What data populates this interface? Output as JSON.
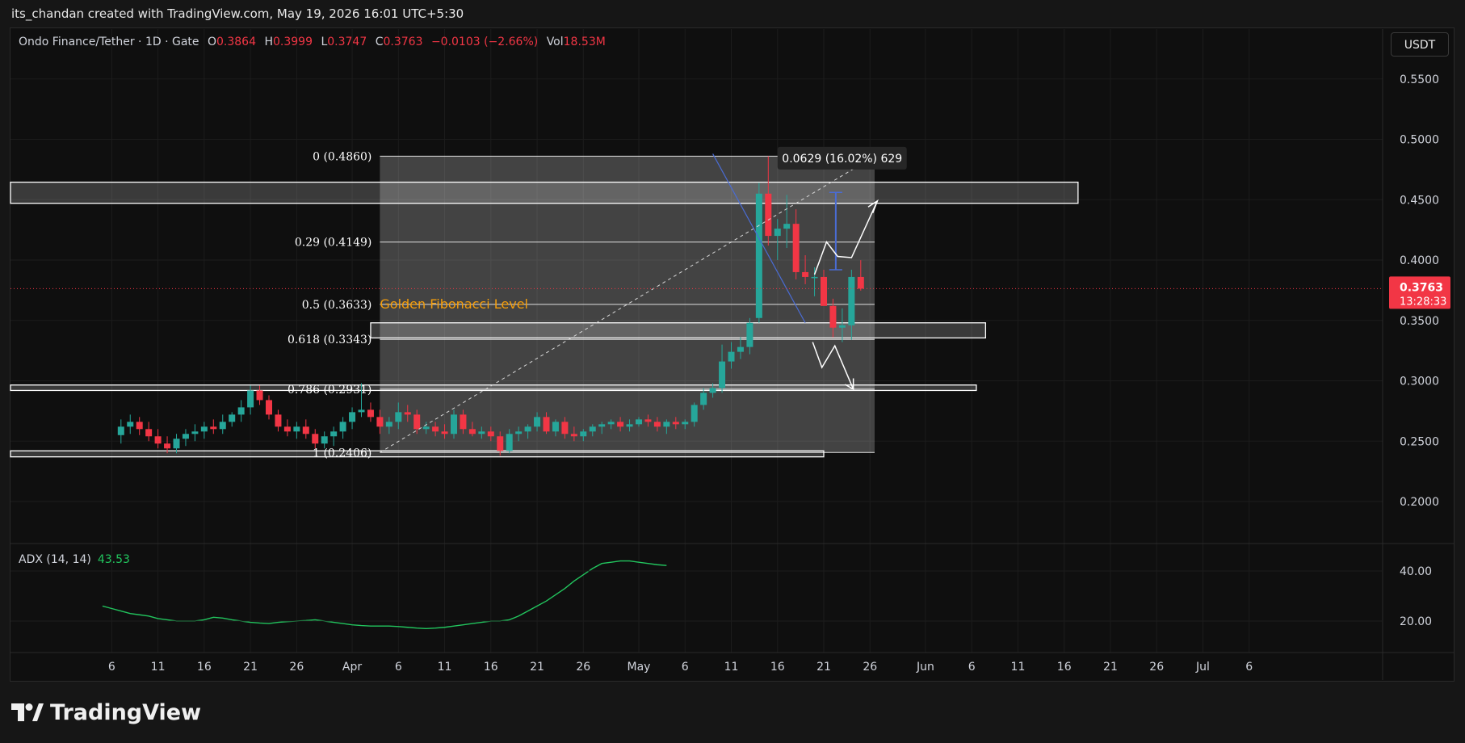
{
  "header": {
    "attribution": "its_chandan created with TradingView.com, May 19, 2026 16:01 UTC+5:30"
  },
  "legend": {
    "symbol": "Ondo Finance/Tether · 1D · Gate",
    "open_label": "O",
    "open": "0.3864",
    "high_label": "H",
    "high": "0.3999",
    "low_label": "L",
    "low": "0.3747",
    "close_label": "C",
    "close": "0.3763",
    "change": "−0.0103 (−2.66%)",
    "vol_label": "Vol",
    "vol": "18.53M"
  },
  "currency_button": "USDT",
  "price_badge": {
    "price": "0.3763",
    "countdown": "13:28:33"
  },
  "adx": {
    "label": "ADX (14, 14)",
    "value": "43.53"
  },
  "brand": "TradingView",
  "colors": {
    "up": "#26a69a",
    "down": "#f23645",
    "adx": "#22c55e",
    "annotation": "#ffffff",
    "trendline": "#4a6cd4",
    "golden_label": "#f59e0b"
  },
  "chart_data": {
    "type": "candlestick",
    "title": "Ondo Finance/Tether · 1D · Gate",
    "ylabel": "USDT",
    "ylim": [
      0.175,
      0.57
    ],
    "y_ticks": [
      "0.5500",
      "0.5000",
      "0.4500",
      "0.4000",
      "0.3500",
      "0.3000",
      "0.2500",
      "0.2000"
    ],
    "x_tick_labels": [
      "6",
      "11",
      "16",
      "21",
      "26",
      "Apr",
      "6",
      "11",
      "16",
      "21",
      "26",
      "May",
      "6",
      "11",
      "16",
      "21",
      "26",
      "Jun",
      "6",
      "11",
      "16",
      "21",
      "26",
      "Jul",
      "6"
    ],
    "x_tick_days": [
      -57,
      -52,
      -47,
      -42,
      -37,
      -31,
      -26,
      -21,
      -16,
      -11,
      -6,
      0,
      5,
      10,
      15,
      20,
      25,
      31,
      36,
      41,
      46,
      51,
      56,
      61,
      66
    ],
    "x_day_note": "days relative to May 1",
    "candles_ohlc": [
      [
        0.255,
        0.268,
        0.248,
        0.262
      ],
      [
        0.262,
        0.272,
        0.256,
        0.266
      ],
      [
        0.266,
        0.27,
        0.255,
        0.26
      ],
      [
        0.26,
        0.266,
        0.25,
        0.254
      ],
      [
        0.254,
        0.26,
        0.244,
        0.248
      ],
      [
        0.248,
        0.254,
        0.24,
        0.244
      ],
      [
        0.244,
        0.256,
        0.24,
        0.252
      ],
      [
        0.252,
        0.26,
        0.246,
        0.256
      ],
      [
        0.256,
        0.264,
        0.25,
        0.258
      ],
      [
        0.258,
        0.266,
        0.252,
        0.262
      ],
      [
        0.262,
        0.268,
        0.256,
        0.26
      ],
      [
        0.26,
        0.272,
        0.256,
        0.266
      ],
      [
        0.266,
        0.274,
        0.262,
        0.272
      ],
      [
        0.272,
        0.284,
        0.266,
        0.278
      ],
      [
        0.278,
        0.296,
        0.272,
        0.292
      ],
      [
        0.292,
        0.296,
        0.28,
        0.284
      ],
      [
        0.284,
        0.288,
        0.268,
        0.272
      ],
      [
        0.272,
        0.276,
        0.258,
        0.262
      ],
      [
        0.262,
        0.268,
        0.254,
        0.258
      ],
      [
        0.258,
        0.266,
        0.252,
        0.262
      ],
      [
        0.262,
        0.268,
        0.252,
        0.256
      ],
      [
        0.256,
        0.26,
        0.244,
        0.248
      ],
      [
        0.248,
        0.258,
        0.244,
        0.254
      ],
      [
        0.254,
        0.262,
        0.246,
        0.258
      ],
      [
        0.258,
        0.27,
        0.252,
        0.266
      ],
      [
        0.266,
        0.278,
        0.26,
        0.274
      ],
      [
        0.274,
        0.298,
        0.27,
        0.276
      ],
      [
        0.276,
        0.282,
        0.266,
        0.27
      ],
      [
        0.27,
        0.276,
        0.256,
        0.262
      ],
      [
        0.262,
        0.27,
        0.256,
        0.266
      ],
      [
        0.266,
        0.282,
        0.26,
        0.274
      ],
      [
        0.274,
        0.28,
        0.266,
        0.272
      ],
      [
        0.272,
        0.276,
        0.256,
        0.26
      ],
      [
        0.26,
        0.266,
        0.256,
        0.262
      ],
      [
        0.262,
        0.266,
        0.254,
        0.258
      ],
      [
        0.258,
        0.264,
        0.252,
        0.256
      ],
      [
        0.256,
        0.276,
        0.252,
        0.272
      ],
      [
        0.272,
        0.276,
        0.256,
        0.26
      ],
      [
        0.26,
        0.266,
        0.254,
        0.256
      ],
      [
        0.256,
        0.262,
        0.252,
        0.258
      ],
      [
        0.258,
        0.262,
        0.25,
        0.254
      ],
      [
        0.254,
        0.258,
        0.238,
        0.242
      ],
      [
        0.242,
        0.26,
        0.24,
        0.256
      ],
      [
        0.256,
        0.262,
        0.25,
        0.258
      ],
      [
        0.258,
        0.264,
        0.252,
        0.262
      ],
      [
        0.262,
        0.274,
        0.258,
        0.27
      ],
      [
        0.27,
        0.274,
        0.256,
        0.258
      ],
      [
        0.258,
        0.268,
        0.254,
        0.266
      ],
      [
        0.266,
        0.27,
        0.252,
        0.256
      ],
      [
        0.256,
        0.262,
        0.25,
        0.254
      ],
      [
        0.254,
        0.26,
        0.25,
        0.258
      ],
      [
        0.258,
        0.264,
        0.254,
        0.262
      ],
      [
        0.262,
        0.266,
        0.256,
        0.264
      ],
      [
        0.264,
        0.268,
        0.26,
        0.266
      ],
      [
        0.266,
        0.27,
        0.258,
        0.262
      ],
      [
        0.262,
        0.268,
        0.258,
        0.264
      ],
      [
        0.264,
        0.27,
        0.262,
        0.268
      ],
      [
        0.268,
        0.272,
        0.262,
        0.266
      ],
      [
        0.266,
        0.27,
        0.258,
        0.262
      ],
      [
        0.262,
        0.268,
        0.256,
        0.266
      ],
      [
        0.266,
        0.27,
        0.26,
        0.264
      ],
      [
        0.264,
        0.268,
        0.26,
        0.266
      ],
      [
        0.266,
        0.282,
        0.262,
        0.28
      ],
      [
        0.28,
        0.294,
        0.276,
        0.29
      ],
      [
        0.29,
        0.298,
        0.286,
        0.294
      ],
      [
        0.294,
        0.33,
        0.29,
        0.316
      ],
      [
        0.316,
        0.332,
        0.31,
        0.324
      ],
      [
        0.324,
        0.336,
        0.318,
        0.328
      ],
      [
        0.328,
        0.352,
        0.322,
        0.348
      ],
      [
        0.352,
        0.464,
        0.348,
        0.455
      ],
      [
        0.455,
        0.486,
        0.412,
        0.42
      ],
      [
        0.42,
        0.434,
        0.4,
        0.426
      ],
      [
        0.426,
        0.454,
        0.41,
        0.43
      ],
      [
        0.43,
        0.442,
        0.384,
        0.39
      ],
      [
        0.39,
        0.404,
        0.38,
        0.386
      ],
      [
        0.386,
        0.394,
        0.37,
        0.386
      ],
      [
        0.386,
        0.392,
        0.366,
        0.362
      ],
      [
        0.362,
        0.368,
        0.336,
        0.344
      ],
      [
        0.344,
        0.36,
        0.332,
        0.346
      ],
      [
        0.346,
        0.392,
        0.334,
        0.386
      ],
      [
        0.386,
        0.3999,
        0.3747,
        0.3763
      ]
    ],
    "candles_first_day": -56,
    "fibonacci": {
      "levels": [
        {
          "ratio_label": "0 (0.4860)",
          "price": 0.486
        },
        {
          "ratio_label": "0.29 (0.4149)",
          "price": 0.4149
        },
        {
          "ratio_label": "0.5 (0.3633)",
          "price": 0.3633
        },
        {
          "ratio_label": "0.618 (0.3343)",
          "price": 0.3343
        },
        {
          "ratio_label": "0.786 (0.2931)",
          "price": 0.2931
        },
        {
          "ratio_label": "1 (0.2406)",
          "price": 0.2406
        }
      ]
    },
    "golden_label": "Golden Fibonacci Level",
    "measure_label": "0.0629 (16.02%) 629",
    "adx_series": [
      26,
      25,
      24,
      23,
      22.5,
      22,
      21,
      20.5,
      20,
      20,
      20,
      20.5,
      21.5,
      21.2,
      20.5,
      20,
      19.5,
      19.2,
      19,
      19.5,
      19.8,
      20,
      20.2,
      20.5,
      20,
      19.5,
      19,
      18.5,
      18.2,
      18,
      18,
      18,
      17.8,
      17.5,
      17.2,
      17,
      17.2,
      17.5,
      18,
      18.5,
      19,
      19.5,
      20,
      20,
      20.5,
      22,
      24,
      26,
      28,
      30.5,
      33,
      36,
      38.5,
      41,
      43,
      43.5,
      44,
      44,
      43.5,
      43,
      42.5,
      42.2
    ],
    "adx_first_day": -58,
    "adx_ticks": [
      "40.00",
      "20.00"
    ]
  }
}
